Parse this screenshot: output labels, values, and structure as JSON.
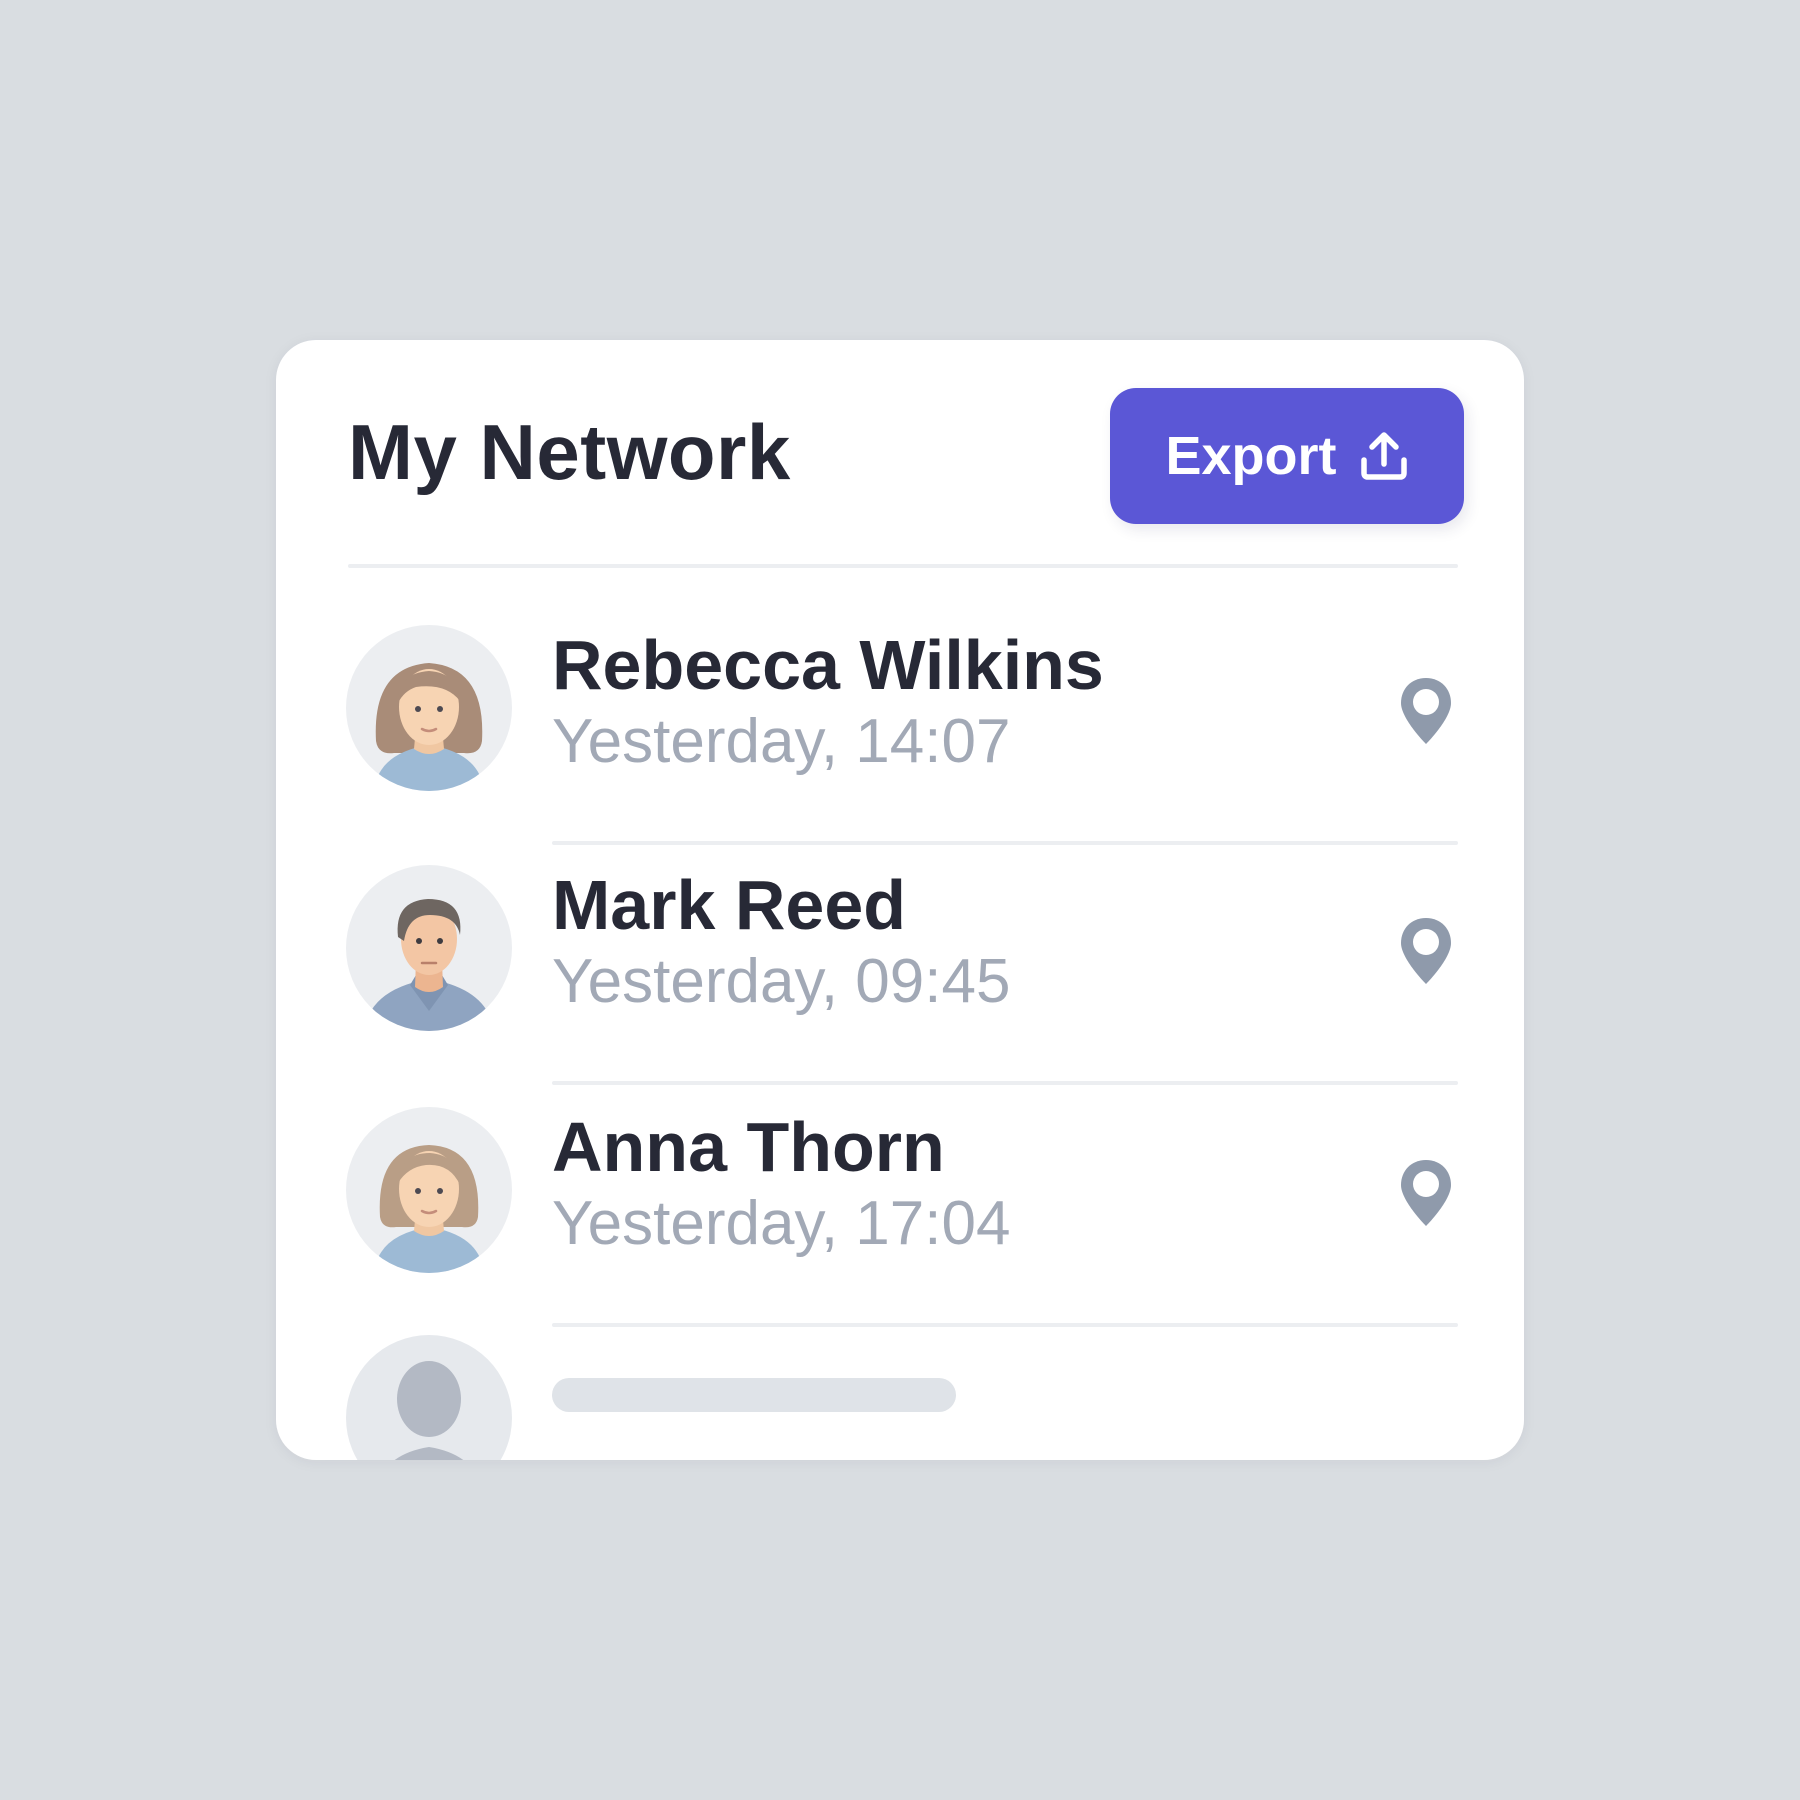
{
  "header": {
    "title": "My Network",
    "export_label": "Export",
    "export_icon": "upload-icon",
    "accent_color": "#5b57d6"
  },
  "contacts": [
    {
      "name": "Rebecca Wilkins",
      "time": "Yesterday, 14:07",
      "avatar": "woman-avatar",
      "action_icon": "location-pin-icon"
    },
    {
      "name": "Mark Reed",
      "time": "Yesterday, 09:45",
      "avatar": "man-avatar",
      "action_icon": "location-pin-icon"
    },
    {
      "name": "Anna Thorn",
      "time": "Yesterday, 17:04",
      "avatar": "woman-avatar",
      "action_icon": "location-pin-icon"
    }
  ],
  "placeholder_row": {
    "avatar": "placeholder-person-avatar",
    "state": "loading"
  }
}
